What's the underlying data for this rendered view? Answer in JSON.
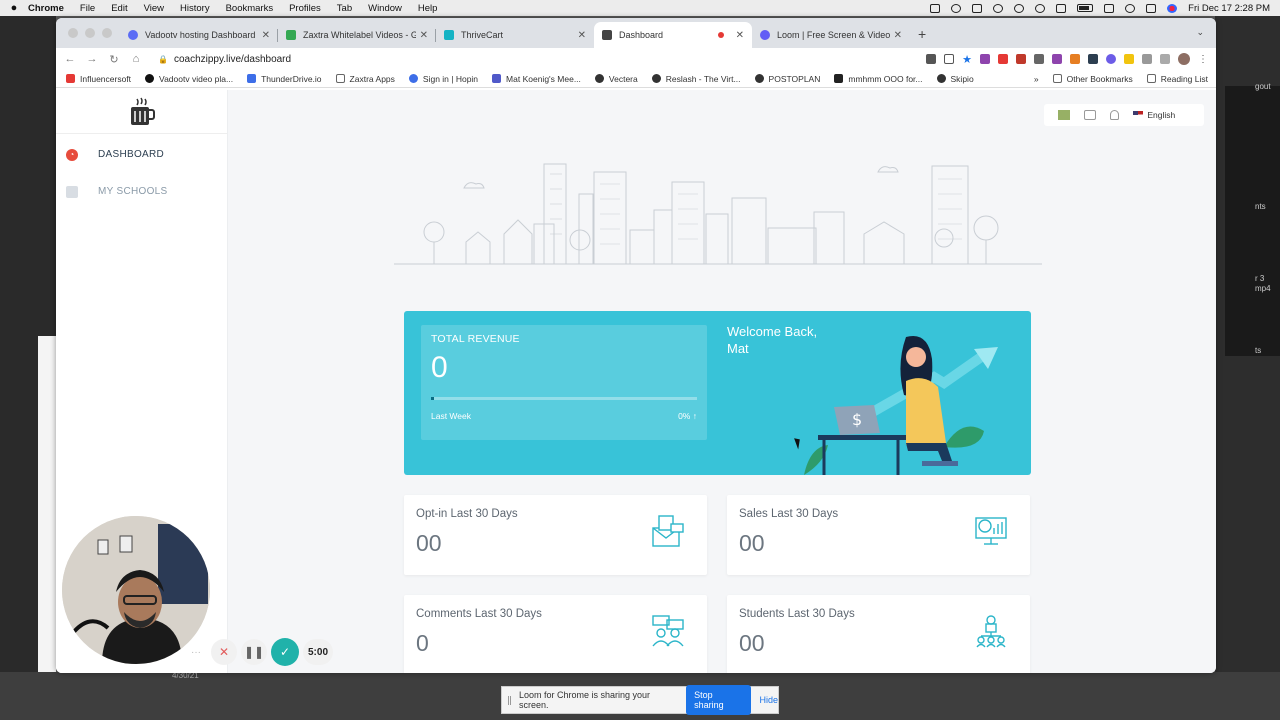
{
  "menubar": {
    "app": "Chrome",
    "menus": [
      "File",
      "Edit",
      "View",
      "History",
      "Bookmarks",
      "Profiles",
      "Tab",
      "Window",
      "Help"
    ],
    "clock": "Fri Dec 17  2:28 PM"
  },
  "browser": {
    "tabs": [
      {
        "label": "Vadootv hosting Dashboard Re",
        "color": "#5b6cf5"
      },
      {
        "label": "Zaxtra Whitelabel Videos - Go",
        "color": "#34a853"
      },
      {
        "label": "ThriveCart",
        "color": "#15b3c4"
      },
      {
        "label": "Dashboard",
        "color": "#444444"
      },
      {
        "label": "Loom | Free Screen & Video Re",
        "color": "#625df5"
      }
    ],
    "url": "coachzippy.live/dashboard",
    "bookmarks": [
      {
        "label": "Influencersoft",
        "color": "#e53935"
      },
      {
        "label": "Vadootv video pla...",
        "color": "#111111"
      },
      {
        "label": "ThunderDrive.io",
        "color": "#3d6ee8"
      },
      {
        "label": "Zaxtra Apps",
        "color": "#888888"
      },
      {
        "label": "Sign in | Hopin",
        "color": "#3d6ee8"
      },
      {
        "label": "Mat Koenig's Mee...",
        "color": "#5059c9"
      },
      {
        "label": "Vectera",
        "color": "#333333"
      },
      {
        "label": "Reslash - The Virt...",
        "color": "#333333"
      },
      {
        "label": "POSTOPLAN",
        "color": "#333333"
      },
      {
        "label": "mmhmm OOO for...",
        "color": "#222222"
      },
      {
        "label": "Skipio",
        "color": "#333333"
      }
    ],
    "other_bookmarks": "Other Bookmarks",
    "reading_list": "Reading List"
  },
  "sidebar": {
    "items": [
      {
        "label": "DASHBOARD",
        "active": true
      },
      {
        "label": "MY SCHOOLS",
        "active": false
      }
    ]
  },
  "topright": {
    "language": "English"
  },
  "revenue": {
    "label": "TOTAL REVENUE",
    "value": "0",
    "period": "Last Week",
    "change": "0%",
    "progress": 0,
    "welcome_line1": "Welcome Back,",
    "welcome_name": "Mat"
  },
  "stats": [
    {
      "label": "Opt-in Last 30 Days",
      "value": "00"
    },
    {
      "label": "Sales Last 30 Days",
      "value": "00"
    },
    {
      "label": "Comments Last 30 Days",
      "value": "0"
    },
    {
      "label": "Students Last 30 Days",
      "value": "00"
    }
  ],
  "loom": {
    "timer": "5:00",
    "share_text": "Loom for Chrome is sharing your screen.",
    "stop_label": "Stop sharing",
    "hide_label": "Hide"
  },
  "background": {
    "right_texts": [
      "gout",
      "nts",
      "r 3",
      "mp4",
      "ts"
    ],
    "bottom_text": "4/30/21"
  },
  "colors": {
    "accent": "#38c3d8",
    "brand_red": "#e74c3c",
    "icon_teal": "#2bb5c9"
  }
}
